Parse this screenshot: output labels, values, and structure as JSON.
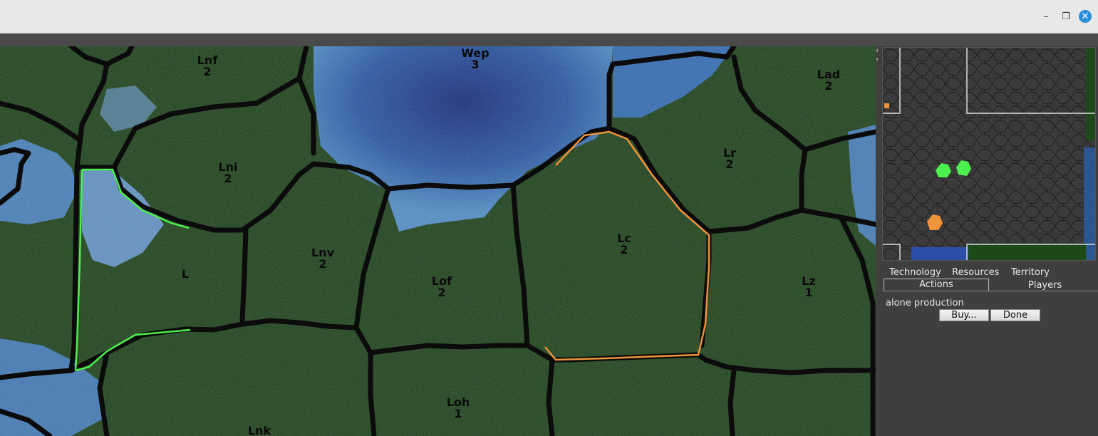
{
  "window": {
    "minimize_icon": "minimize-icon",
    "maximize_icon": "restore-icon",
    "close_icon": "close-icon",
    "minimize_glyph": "–",
    "maximize_glyph": "❐",
    "close_glyph": "✕"
  },
  "map": {
    "regions": [
      {
        "name": "Lnf",
        "value": "2"
      },
      {
        "name": "Wep",
        "value": "3"
      },
      {
        "name": "Lad",
        "value": "2"
      },
      {
        "name": "Lni",
        "value": "2"
      },
      {
        "name": "Lr",
        "value": "2"
      },
      {
        "name": "Lc",
        "value": "2"
      },
      {
        "name": "Lnv",
        "value": "2"
      },
      {
        "name": "L",
        "value": ""
      },
      {
        "name": "Lof",
        "value": "2"
      },
      {
        "name": "Lz",
        "value": "1"
      },
      {
        "name": "Loh",
        "value": "1"
      },
      {
        "name": "Lnk",
        "value": ""
      }
    ],
    "colors": {
      "land": "#12350f",
      "water": "#1c4f9a",
      "border": "#0b0b0b",
      "player_green": "#4cf04c",
      "player_orange": "#f0943a"
    }
  },
  "sidebar": {
    "collapse_left": "‹",
    "collapse_right": "›",
    "tabs_row1": [
      "Technology",
      "Resources",
      "Territory"
    ],
    "tabs_row2": [
      "Actions",
      "Players"
    ],
    "active_tab": "Actions",
    "status_text": "alone production",
    "buy_label": "Buy...",
    "done_label": "Done"
  }
}
